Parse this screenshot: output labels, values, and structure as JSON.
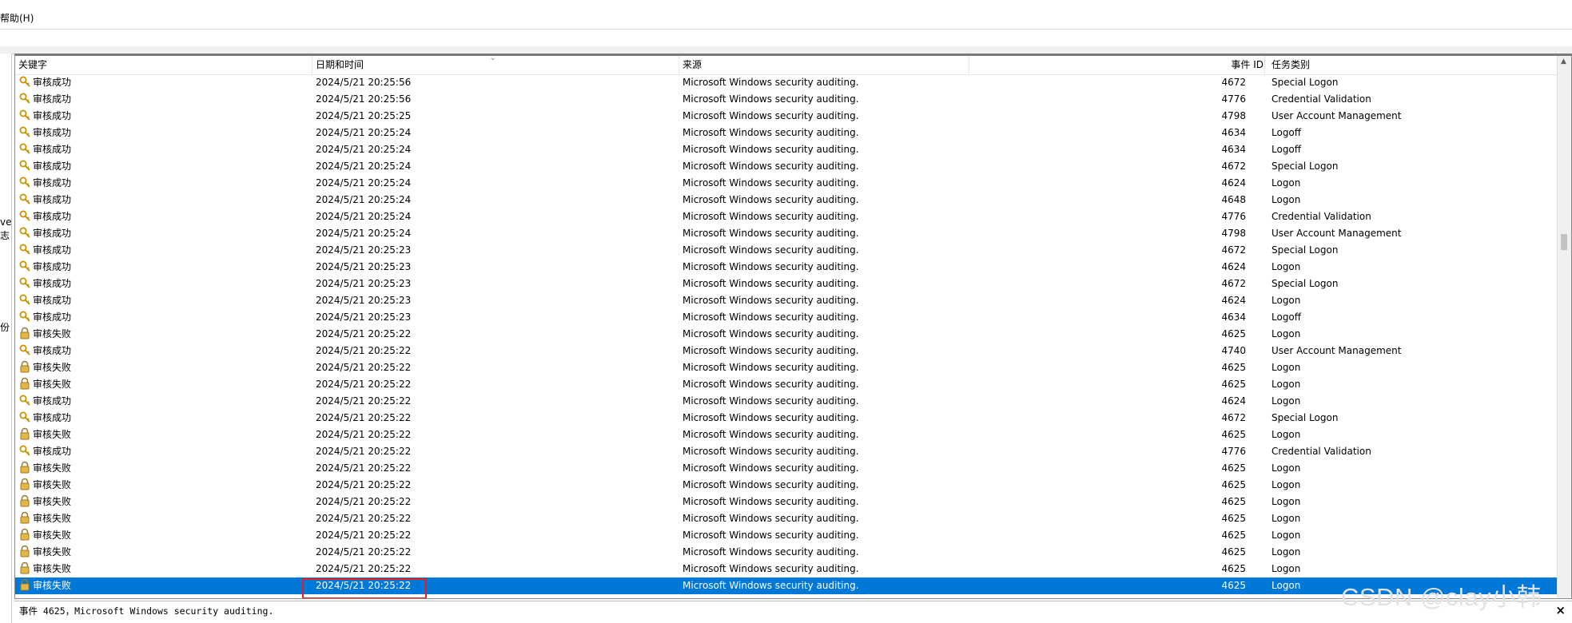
{
  "menu": {
    "help": "帮助(H)"
  },
  "left_pane": {
    "frag1": "ve",
    "frag2": "志",
    "frag3": "份"
  },
  "columns": {
    "keyword": "关键字",
    "datetime": "日期和时间",
    "source": "来源",
    "event_id": "事件 ID",
    "task_category": "任务类别"
  },
  "icons": {
    "success": "key-icon",
    "failure": "lock-icon",
    "close": "close-icon",
    "up": "chevron-up-icon"
  },
  "colors": {
    "selection": "#0078d7",
    "highlight_box": "#e02020"
  },
  "rows": [
    {
      "kw": "审核成功",
      "status": "success",
      "dt": "2024/5/21 20:25:56",
      "src": "Microsoft Windows security auditing.",
      "id": "4672",
      "task": "Special Logon"
    },
    {
      "kw": "审核成功",
      "status": "success",
      "dt": "2024/5/21 20:25:56",
      "src": "Microsoft Windows security auditing.",
      "id": "4776",
      "task": "Credential Validation"
    },
    {
      "kw": "审核成功",
      "status": "success",
      "dt": "2024/5/21 20:25:25",
      "src": "Microsoft Windows security auditing.",
      "id": "4798",
      "task": "User Account Management"
    },
    {
      "kw": "审核成功",
      "status": "success",
      "dt": "2024/5/21 20:25:24",
      "src": "Microsoft Windows security auditing.",
      "id": "4634",
      "task": "Logoff"
    },
    {
      "kw": "审核成功",
      "status": "success",
      "dt": "2024/5/21 20:25:24",
      "src": "Microsoft Windows security auditing.",
      "id": "4634",
      "task": "Logoff"
    },
    {
      "kw": "审核成功",
      "status": "success",
      "dt": "2024/5/21 20:25:24",
      "src": "Microsoft Windows security auditing.",
      "id": "4672",
      "task": "Special Logon"
    },
    {
      "kw": "审核成功",
      "status": "success",
      "dt": "2024/5/21 20:25:24",
      "src": "Microsoft Windows security auditing.",
      "id": "4624",
      "task": "Logon"
    },
    {
      "kw": "审核成功",
      "status": "success",
      "dt": "2024/5/21 20:25:24",
      "src": "Microsoft Windows security auditing.",
      "id": "4648",
      "task": "Logon"
    },
    {
      "kw": "审核成功",
      "status": "success",
      "dt": "2024/5/21 20:25:24",
      "src": "Microsoft Windows security auditing.",
      "id": "4776",
      "task": "Credential Validation"
    },
    {
      "kw": "审核成功",
      "status": "success",
      "dt": "2024/5/21 20:25:24",
      "src": "Microsoft Windows security auditing.",
      "id": "4798",
      "task": "User Account Management"
    },
    {
      "kw": "审核成功",
      "status": "success",
      "dt": "2024/5/21 20:25:23",
      "src": "Microsoft Windows security auditing.",
      "id": "4672",
      "task": "Special Logon"
    },
    {
      "kw": "审核成功",
      "status": "success",
      "dt": "2024/5/21 20:25:23",
      "src": "Microsoft Windows security auditing.",
      "id": "4624",
      "task": "Logon"
    },
    {
      "kw": "审核成功",
      "status": "success",
      "dt": "2024/5/21 20:25:23",
      "src": "Microsoft Windows security auditing.",
      "id": "4672",
      "task": "Special Logon"
    },
    {
      "kw": "审核成功",
      "status": "success",
      "dt": "2024/5/21 20:25:23",
      "src": "Microsoft Windows security auditing.",
      "id": "4624",
      "task": "Logon"
    },
    {
      "kw": "审核成功",
      "status": "success",
      "dt": "2024/5/21 20:25:23",
      "src": "Microsoft Windows security auditing.",
      "id": "4634",
      "task": "Logoff"
    },
    {
      "kw": "审核失败",
      "status": "failure",
      "dt": "2024/5/21 20:25:22",
      "src": "Microsoft Windows security auditing.",
      "id": "4625",
      "task": "Logon"
    },
    {
      "kw": "审核成功",
      "status": "success",
      "dt": "2024/5/21 20:25:22",
      "src": "Microsoft Windows security auditing.",
      "id": "4740",
      "task": "User Account Management"
    },
    {
      "kw": "审核失败",
      "status": "failure",
      "dt": "2024/5/21 20:25:22",
      "src": "Microsoft Windows security auditing.",
      "id": "4625",
      "task": "Logon"
    },
    {
      "kw": "审核失败",
      "status": "failure",
      "dt": "2024/5/21 20:25:22",
      "src": "Microsoft Windows security auditing.",
      "id": "4625",
      "task": "Logon"
    },
    {
      "kw": "审核成功",
      "status": "success",
      "dt": "2024/5/21 20:25:22",
      "src": "Microsoft Windows security auditing.",
      "id": "4624",
      "task": "Logon"
    },
    {
      "kw": "审核成功",
      "status": "success",
      "dt": "2024/5/21 20:25:22",
      "src": "Microsoft Windows security auditing.",
      "id": "4672",
      "task": "Special Logon"
    },
    {
      "kw": "审核失败",
      "status": "failure",
      "dt": "2024/5/21 20:25:22",
      "src": "Microsoft Windows security auditing.",
      "id": "4625",
      "task": "Logon"
    },
    {
      "kw": "审核成功",
      "status": "success",
      "dt": "2024/5/21 20:25:22",
      "src": "Microsoft Windows security auditing.",
      "id": "4776",
      "task": "Credential Validation"
    },
    {
      "kw": "审核失败",
      "status": "failure",
      "dt": "2024/5/21 20:25:22",
      "src": "Microsoft Windows security auditing.",
      "id": "4625",
      "task": "Logon"
    },
    {
      "kw": "审核失败",
      "status": "failure",
      "dt": "2024/5/21 20:25:22",
      "src": "Microsoft Windows security auditing.",
      "id": "4625",
      "task": "Logon"
    },
    {
      "kw": "审核失败",
      "status": "failure",
      "dt": "2024/5/21 20:25:22",
      "src": "Microsoft Windows security auditing.",
      "id": "4625",
      "task": "Logon"
    },
    {
      "kw": "审核失败",
      "status": "failure",
      "dt": "2024/5/21 20:25:22",
      "src": "Microsoft Windows security auditing.",
      "id": "4625",
      "task": "Logon"
    },
    {
      "kw": "审核失败",
      "status": "failure",
      "dt": "2024/5/21 20:25:22",
      "src": "Microsoft Windows security auditing.",
      "id": "4625",
      "task": "Logon"
    },
    {
      "kw": "审核失败",
      "status": "failure",
      "dt": "2024/5/21 20:25:22",
      "src": "Microsoft Windows security auditing.",
      "id": "4625",
      "task": "Logon"
    },
    {
      "kw": "审核失败",
      "status": "failure",
      "dt": "2024/5/21 20:25:22",
      "src": "Microsoft Windows security auditing.",
      "id": "4625",
      "task": "Logon"
    },
    {
      "kw": "审核失败",
      "status": "failure",
      "dt": "2024/5/21 20:25:22",
      "src": "Microsoft Windows security auditing.",
      "id": "4625",
      "task": "Logon",
      "selected": true
    }
  ],
  "detail": {
    "text": "事件 4625，Microsoft Windows security auditing."
  },
  "watermark": "CSDN @clay小韩"
}
